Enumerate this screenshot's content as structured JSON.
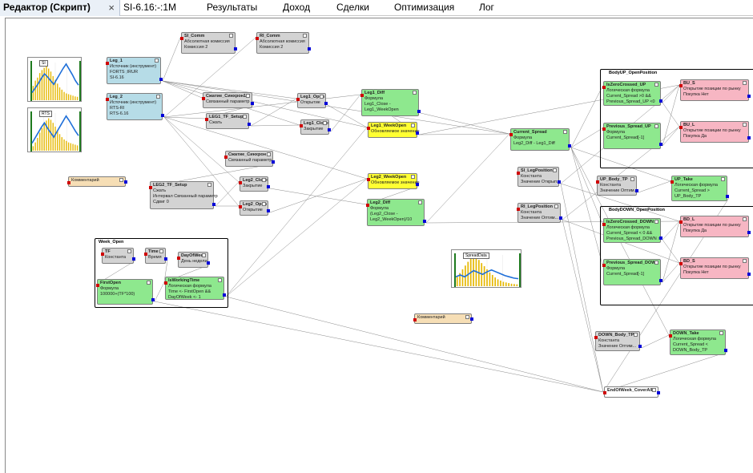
{
  "tabs": [
    {
      "label": "Редактор (Скрипт)",
      "active": true,
      "close": "×"
    },
    {
      "label": "SI-6.16:-:1M"
    },
    {
      "label": "Результаты"
    },
    {
      "label": "Доход"
    },
    {
      "label": "Сделки"
    },
    {
      "label": "Оптимизация"
    },
    {
      "label": "Лог"
    }
  ],
  "colors": {
    "input_pin": "#d00000",
    "output_pin": "#0000d8",
    "bar": "#e6b800",
    "line": "#1e6fd9",
    "border_green": "#1e7a1e"
  },
  "charts": {
    "si": {
      "label": "SI",
      "bars": [
        38,
        52,
        60,
        72,
        80,
        86,
        90,
        84,
        76,
        64,
        54,
        44,
        34,
        28,
        22,
        18,
        16,
        14,
        12,
        10,
        9
      ],
      "line": [
        20,
        32,
        44,
        58,
        70,
        62,
        52,
        42,
        56,
        70,
        84,
        96,
        82,
        68,
        52,
        40
      ]
    },
    "rts": {
      "label": "RTS",
      "bars": [
        12,
        22,
        34,
        48,
        60,
        72,
        80,
        86,
        82,
        74,
        64,
        54,
        44,
        36,
        30,
        26,
        22,
        20,
        18,
        16,
        14
      ],
      "line": [
        20,
        34,
        48,
        62,
        74,
        60,
        48,
        36,
        50,
        64,
        78,
        92,
        80,
        66,
        52,
        40
      ]
    },
    "spread": {
      "label": "SpreadData",
      "bars": [
        30,
        42,
        54,
        66,
        78,
        88,
        94,
        92,
        84,
        74,
        64,
        54,
        44,
        36,
        28,
        22,
        18,
        14,
        12,
        10,
        8,
        7,
        6
      ],
      "line": [
        30,
        36,
        30,
        40,
        50,
        44,
        38,
        46,
        52,
        46,
        40,
        34,
        30,
        26,
        24
      ]
    }
  },
  "nodes": {
    "si_comm": {
      "title": "SI_Comm",
      "lines": [
        "Абсолютная комиссия",
        "Комиссия      2"
      ]
    },
    "ri_comm": {
      "title": "RI_Comm",
      "lines": [
        "Абсолютная комиссия",
        "Комиссия      2"
      ]
    },
    "leg1": {
      "title": "Leg_1",
      "lines": [
        "Источник (инструмент)",
        "FORTS ;IRUR",
        "SI-6.16"
      ]
    },
    "leg2": {
      "title": "Leg_2",
      "lines": [
        "Источник (инструмент)",
        "RTS-RI",
        "RTS-6.16"
      ]
    },
    "compress_sync1": {
      "title": "Сжатие_Синхрон1",
      "lines": [
        "Связанный параметр"
      ]
    },
    "leg1_tf_setup": {
      "title": "LEG1_TF_Setup",
      "lines": [
        "Сжать"
      ]
    },
    "leg1_open": {
      "title": "Leg1_Open",
      "lines": [
        "Открытие"
      ]
    },
    "leg1_close": {
      "title": "Leg1_Close",
      "lines": [
        "Закрытие"
      ]
    },
    "leg1_diff": {
      "title": "Leg1_Diff",
      "lines": [
        "Формула",
        "Leg1_Close -",
        "Leg1_WeekOpen"
      ]
    },
    "leg1_weekopen": {
      "title": "Leg1_WeekOpen",
      "lines": [
        "Обновляемое значение"
      ]
    },
    "current_spread": {
      "title": "Current_Spread",
      "lines": [
        "Формула",
        "Leg2_Diff - Leg1_Diff"
      ]
    },
    "si_legposition": {
      "title": "SI_LegPosition",
      "lines": [
        "Константа",
        "Значение Открып..."
      ]
    },
    "ri_legposition": {
      "title": "RI_LegPosition",
      "lines": [
        "Константа",
        "Значение Оптим..."
      ]
    },
    "comment1": {
      "title": "",
      "lines": [
        "Комментарий"
      ]
    },
    "leg2_tf_setup": {
      "title": "LEG2_TF_Setup",
      "lines": [
        "Сжать",
        "Интервал Связанный параметр",
        "Сдвиг                         0"
      ]
    },
    "compress_sync2": {
      "title": "Сжатие_Синхрон",
      "lines": [
        "Связанный параметр"
      ]
    },
    "leg2_close": {
      "title": "Leg2_Close",
      "lines": [
        "Закрытие"
      ]
    },
    "leg2_open": {
      "title": "Leg2_Open",
      "lines": [
        "Открытие"
      ]
    },
    "leg2_weekopen": {
      "title": "Leg2_WeekOpen",
      "lines": [
        "Обновляемое значение"
      ]
    },
    "leg2_diff": {
      "title": "Leg2_Diff",
      "lines": [
        "Формула",
        "(Leg2_Close -",
        "Leg2_WeekOpen)/10"
      ]
    },
    "week_open": {
      "title": "Week_Open",
      "lines": []
    },
    "tf": {
      "title": "TF",
      "lines": [
        "Константа"
      ]
    },
    "time": {
      "title": "Time",
      "lines": [
        "Время"
      ]
    },
    "dayofweek": {
      "title": "DayOfWeek",
      "lines": [
        "День недели"
      ]
    },
    "firstopen": {
      "title": "FirstOpen",
      "lines": [
        "Формула",
        "100000+(TF*100)"
      ]
    },
    "isworkingtime": {
      "title": "IsWorkingTime",
      "lines": [
        "Логическая формула",
        "Time <- FirstOpen &&",
        "DayOfWeek <-  1"
      ]
    },
    "comment2": {
      "title": "",
      "lines": [
        "Комментарий"
      ]
    },
    "bodyup": {
      "title": "BodyUP_OpenPosition",
      "lines": []
    },
    "iszerocrossed_up": {
      "title": "IsZeroCrossed_UP",
      "lines": [
        "Логическая формула",
        "Current_Spread >0 &&",
        "Previous_Spread_UP <0"
      ]
    },
    "previous_spread_up": {
      "title": "Previous_Spread_UP",
      "lines": [
        "Формула",
        "Current_Spread[-1]"
      ]
    },
    "bu_s": {
      "title": "BU_S",
      "lines": [
        "Открытие позиции по рынку",
        "Покупка    Нет"
      ]
    },
    "bu_l": {
      "title": "BU_L",
      "lines": [
        "Открытие позиции по рынку",
        "Покупка     Да"
      ]
    },
    "up_body_tp": {
      "title": "UP_Body_TP",
      "lines": [
        "Константа",
        "Значение Оптим..."
      ]
    },
    "up_take": {
      "title": "UP_Take",
      "lines": [
        "Логическая формула",
        "Current_Spread >",
        "UP_Body_TP"
      ]
    },
    "bodydown": {
      "title": "BodyDOWN_OpenPosition",
      "lines": []
    },
    "iszerocrossed_down": {
      "title": "IsZeroCrossed_DOWN",
      "lines": [
        "Логическая формула",
        "Current_Spread < 0 &&",
        "Previous_Spread_DOWN >"
      ]
    },
    "previous_spread_down": {
      "title": "Previous_Spread_DOWN",
      "lines": [
        "Формула",
        "Current_Spread[-1]"
      ]
    },
    "bd_l": {
      "title": "BD_L",
      "lines": [
        "Открытие позиции по рынку",
        "Покупка     Да"
      ]
    },
    "bd_s": {
      "title": "BD_S",
      "lines": [
        "Открытие позиции по рынку",
        "Покупка    Нет"
      ]
    },
    "down_body_tp": {
      "title": "DOWN_Body_TP",
      "lines": [
        "Константа",
        "Значение Оптим..."
      ]
    },
    "down_take": {
      "title": "DOWN_Take",
      "lines": [
        "Логическая формула",
        "Current_Spread <",
        "DOWN_Body_TP"
      ]
    },
    "endofweek": {
      "title": "EndOfWeek_CoverAll",
      "lines": []
    }
  }
}
